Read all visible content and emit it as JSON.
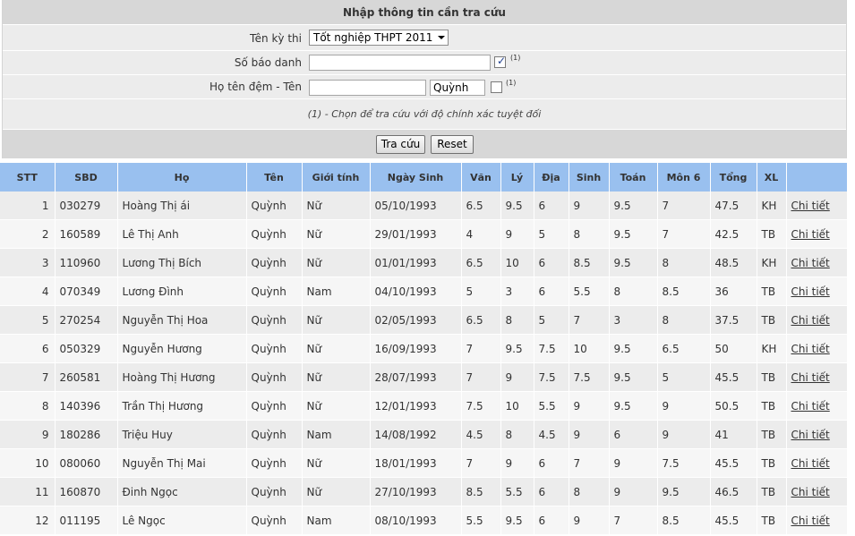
{
  "form": {
    "title": "Nhập thông tin cần tra cứu",
    "exam_label": "Tên kỳ thi",
    "exam_selected": "Tốt nghiệp THPT 2011",
    "sbd_label": "Số báo danh",
    "sbd_value": "",
    "sbd_checked": true,
    "sbd_note_marker": "(1)",
    "name_label": "Họ tên đệm - Tên",
    "middle_name_value": "",
    "first_name_value": "Quỳnh",
    "name_checked": false,
    "name_note_marker": "(1)",
    "note": "(1) - Chọn để tra cứu với độ chính xác tuyệt đối",
    "search_button": "Tra cứu",
    "reset_button": "Reset"
  },
  "table": {
    "headers": [
      "STT",
      "SBD",
      "Họ",
      "Tên",
      "Giới tính",
      "Ngày Sinh",
      "Văn",
      "Lý",
      "Địa",
      "Sinh",
      "Toán",
      "Môn 6",
      "Tổng",
      "XL",
      ""
    ],
    "detail_label": "Chi tiết",
    "rows": [
      [
        "1",
        "030279",
        "Hoàng Thị ái",
        "Quỳnh",
        "Nữ",
        "05/10/1993",
        "6.5",
        "9.5",
        "6",
        "9",
        "9.5",
        "7",
        "47.5",
        "KH"
      ],
      [
        "2",
        "160589",
        "Lê Thị Anh",
        "Quỳnh",
        "Nữ",
        "29/01/1993",
        "4",
        "9",
        "5",
        "8",
        "9.5",
        "7",
        "42.5",
        "TB"
      ],
      [
        "3",
        "110960",
        "Lương Thị Bích",
        "Quỳnh",
        "Nữ",
        "01/01/1993",
        "6.5",
        "10",
        "6",
        "8.5",
        "9.5",
        "8",
        "48.5",
        "KH"
      ],
      [
        "4",
        "070349",
        "Lương Đình",
        "Quỳnh",
        "Nam",
        "04/10/1993",
        "5",
        "3",
        "6",
        "5.5",
        "8",
        "8.5",
        "36",
        "TB"
      ],
      [
        "5",
        "270254",
        "Nguyễn Thị Hoa",
        "Quỳnh",
        "Nữ",
        "02/05/1993",
        "6.5",
        "8",
        "5",
        "7",
        "3",
        "8",
        "37.5",
        "TB"
      ],
      [
        "6",
        "050329",
        "Nguyễn Hương",
        "Quỳnh",
        "Nữ",
        "16/09/1993",
        "7",
        "9.5",
        "7.5",
        "10",
        "9.5",
        "6.5",
        "50",
        "KH"
      ],
      [
        "7",
        "260581",
        "Hoàng Thị Hương",
        "Quỳnh",
        "Nữ",
        "28/07/1993",
        "7",
        "9",
        "7.5",
        "7.5",
        "9.5",
        "5",
        "45.5",
        "TB"
      ],
      [
        "8",
        "140396",
        "Trần Thị Hương",
        "Quỳnh",
        "Nữ",
        "12/01/1993",
        "7.5",
        "10",
        "5.5",
        "9",
        "9.5",
        "9",
        "50.5",
        "TB"
      ],
      [
        "9",
        "180286",
        "Triệu Huy",
        "Quỳnh",
        "Nam",
        "14/08/1992",
        "4.5",
        "8",
        "4.5",
        "9",
        "6",
        "9",
        "41",
        "TB"
      ],
      [
        "10",
        "080060",
        "Nguyễn Thị Mai",
        "Quỳnh",
        "Nữ",
        "18/01/1993",
        "7",
        "9",
        "6",
        "7",
        "9",
        "7.5",
        "45.5",
        "TB"
      ],
      [
        "11",
        "160870",
        "Đinh Ngọc",
        "Quỳnh",
        "Nữ",
        "27/10/1993",
        "8.5",
        "5.5",
        "6",
        "8",
        "9",
        "9.5",
        "46.5",
        "TB"
      ],
      [
        "12",
        "011195",
        "Lê Ngọc",
        "Quỳnh",
        "Nam",
        "08/10/1993",
        "5.5",
        "9.5",
        "6",
        "9",
        "7",
        "8.5",
        "45.5",
        "TB"
      ]
    ]
  }
}
